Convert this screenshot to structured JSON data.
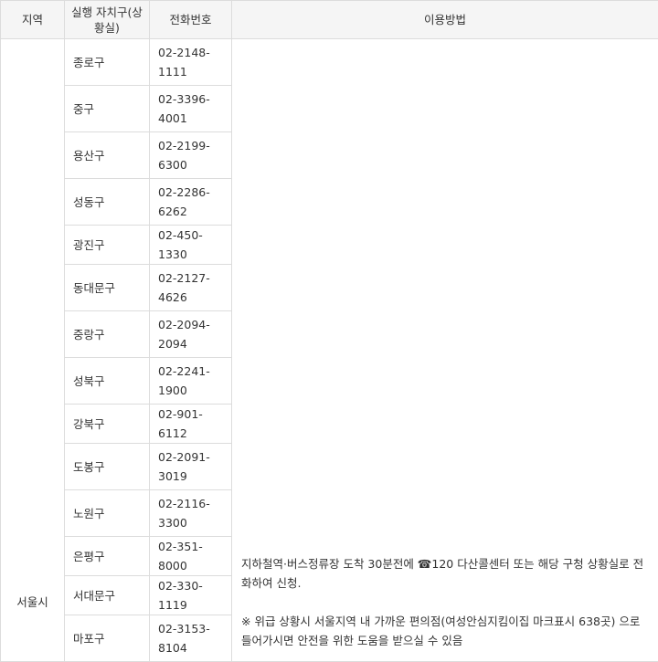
{
  "headers": {
    "region": "지역",
    "district": "실행 자치구(상황실)",
    "phone": "전화번호",
    "usage": "이용방법"
  },
  "region": "서울시",
  "rows": [
    {
      "district": "종로구",
      "phone": "02-2148-1111"
    },
    {
      "district": "중구",
      "phone": "02-3396-4001"
    },
    {
      "district": "용산구",
      "phone": "02-2199-6300"
    },
    {
      "district": "성동구",
      "phone": "02-2286-6262"
    },
    {
      "district": "광진구",
      "phone": "02-450-1330"
    },
    {
      "district": "동대문구",
      "phone": "02-2127-4626"
    },
    {
      "district": "중랑구",
      "phone": "02-2094-2094"
    },
    {
      "district": "성북구",
      "phone": "02-2241-1900"
    },
    {
      "district": "강북구",
      "phone": "02-901-6112"
    },
    {
      "district": "도봉구",
      "phone": "02-2091-3019"
    },
    {
      "district": "노원구",
      "phone": "02-2116-3300"
    },
    {
      "district": "은평구",
      "phone": "02-351-8000"
    },
    {
      "district": "서대문구",
      "phone": "02-330-1119"
    },
    {
      "district": "마포구",
      "phone": "02-3153-8104"
    }
  ],
  "usage": {
    "line1": "지하철역·버스정류장 도착 30분전에 ☎120 다산콜센터 또는 해당 구청 상황실로 전화하여 신청.",
    "line2": "※ 위급 상황시 서울지역 내 가까운 편의점(여성안심지킴이집 마크표시 638곳) 으로 들어가시면 안전을 위한 도움을 받으실 수 있음"
  }
}
